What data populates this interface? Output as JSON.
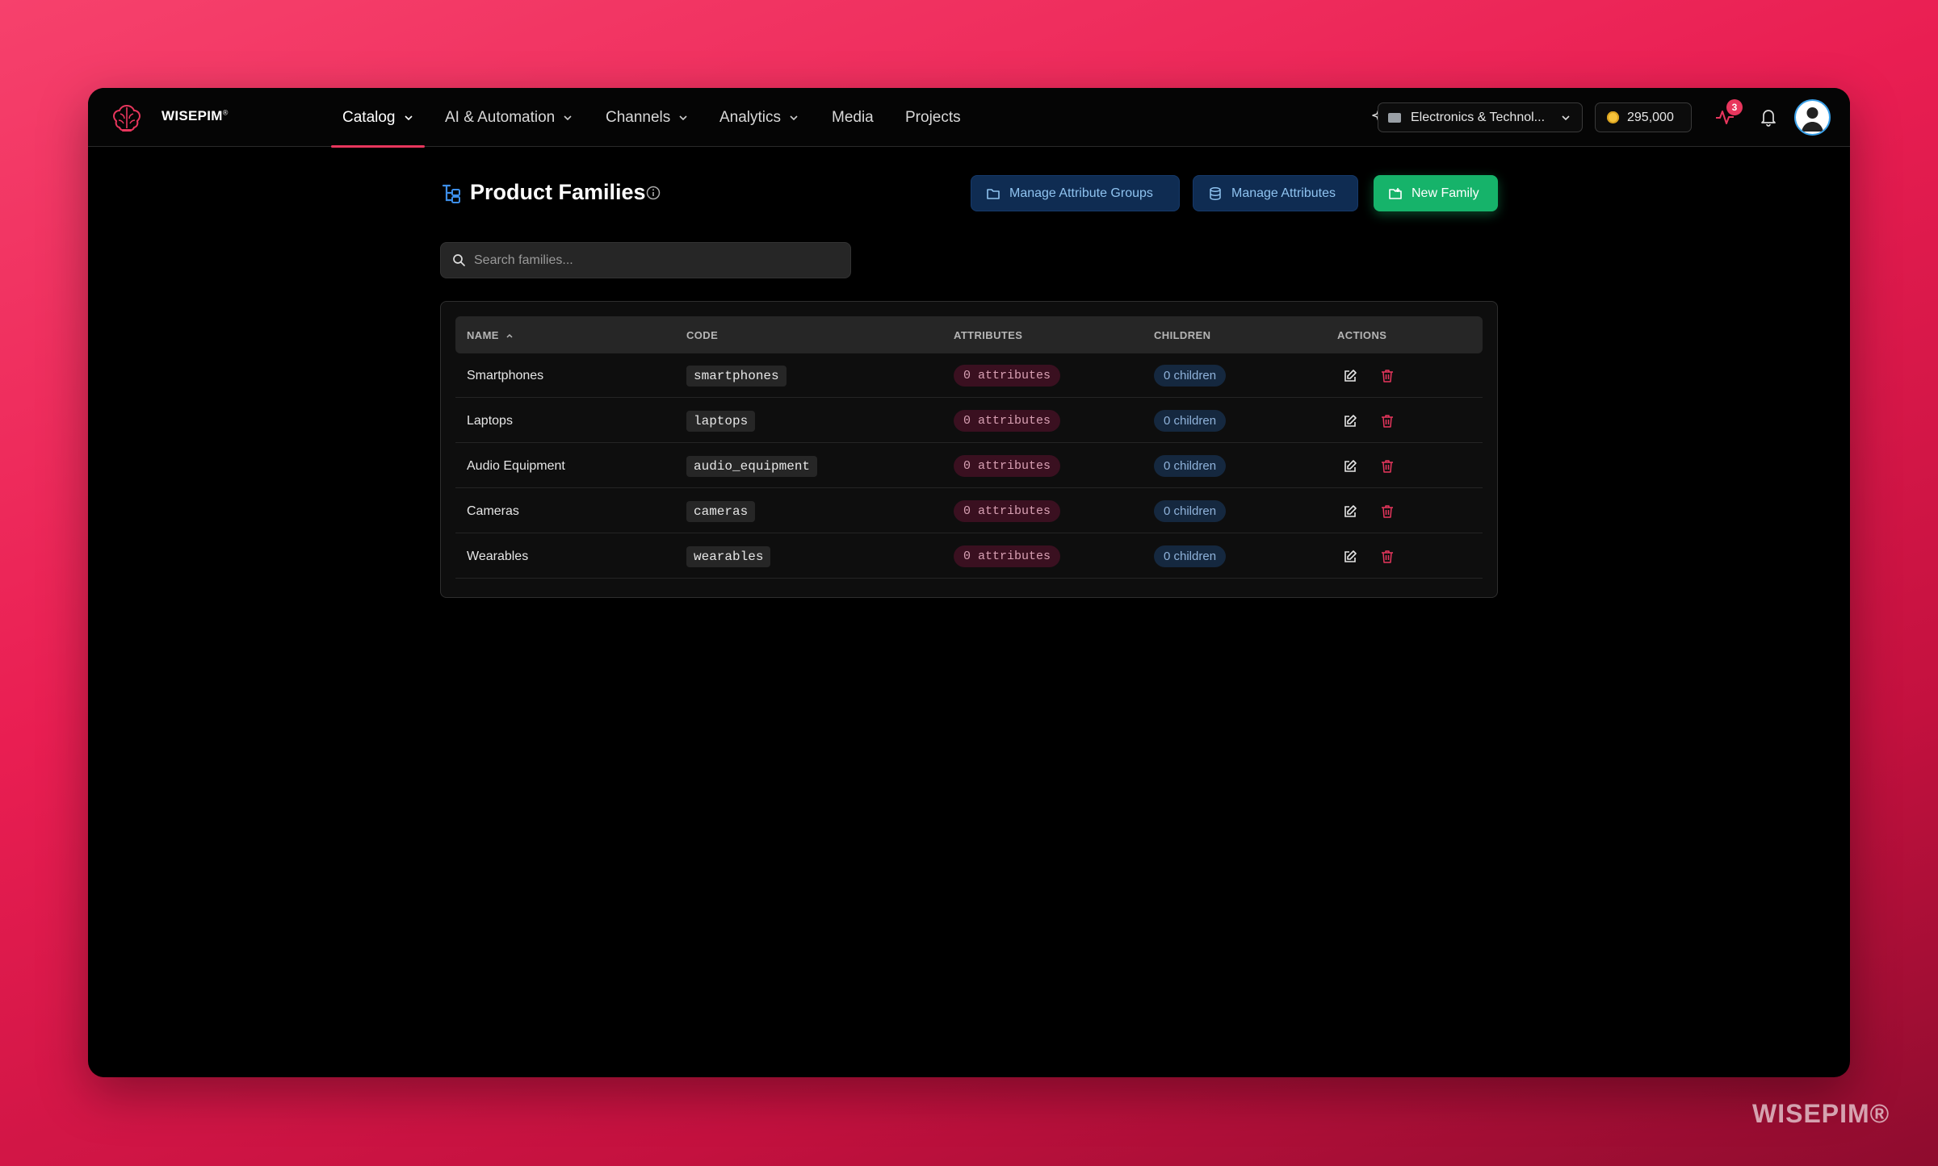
{
  "brand": {
    "name": "WISEPIM",
    "mark": "®"
  },
  "nav": {
    "items": [
      {
        "label": "Catalog",
        "has_dropdown": true,
        "active": true
      },
      {
        "label": "AI & Automation",
        "has_dropdown": true
      },
      {
        "label": "Channels",
        "has_dropdown": true
      },
      {
        "label": "Analytics",
        "has_dropdown": true
      },
      {
        "label": "Media",
        "has_dropdown": false
      },
      {
        "label": "Projects",
        "has_dropdown": false
      }
    ],
    "workspace": "Electronics & Technol...",
    "credits": "295,000",
    "activity_badge": "3",
    "icons": [
      "sparkles-icon",
      "search-icon",
      "activity-icon",
      "bell-icon",
      "user-avatar"
    ]
  },
  "page": {
    "title": "Product Families",
    "buttons": {
      "manage_groups": "Manage Attribute Groups",
      "manage_attributes": "Manage Attributes",
      "new_family": "New Family"
    },
    "search_placeholder": "Search families..."
  },
  "table": {
    "columns": {
      "name": "NAME",
      "code": "CODE",
      "attributes": "ATTRIBUTES",
      "children": "CHILDREN",
      "actions": "ACTIONS"
    },
    "sort": {
      "column": "NAME",
      "direction": "ascending"
    },
    "rows": [
      {
        "name": "Smartphones",
        "code": "smartphones",
        "attributes": "0 attributes",
        "children": "0 children"
      },
      {
        "name": "Laptops",
        "code": "laptops",
        "attributes": "0 attributes",
        "children": "0 children"
      },
      {
        "name": "Audio Equipment",
        "code": "audio_equipment",
        "attributes": "0 attributes",
        "children": "0 children"
      },
      {
        "name": "Cameras",
        "code": "cameras",
        "attributes": "0 attributes",
        "children": "0 children"
      },
      {
        "name": "Wearables",
        "code": "wearables",
        "attributes": "0 attributes",
        "children": "0 children"
      }
    ]
  },
  "watermark": "WISEPIM®",
  "colors": {
    "accent": "#e8365d",
    "primary_button": "#16b36a",
    "secondary_button": "#0f2c52",
    "background_gradient": [
      "#f6416c",
      "#8e0c2e"
    ]
  }
}
